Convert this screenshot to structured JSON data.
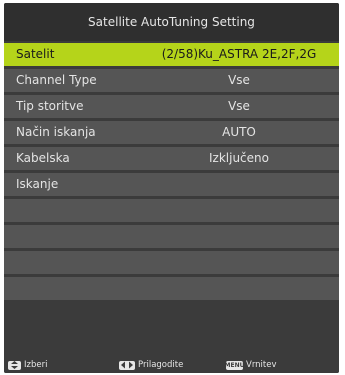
{
  "title": "Satellite AutoTuning Setting",
  "rows": [
    {
      "label": "Satelit",
      "value": "(2/58)Ku_ASTRA 2E,2F,2G"
    },
    {
      "label": "Channel Type",
      "value": "Vse"
    },
    {
      "label": "Tip storitve",
      "value": "Vse"
    },
    {
      "label": "Način iskanja",
      "value": "AUTO"
    },
    {
      "label": "Kabelska",
      "value": "Izključeno"
    },
    {
      "label": "Iskanje",
      "value": ""
    }
  ],
  "hints": {
    "select_label": "Izberi",
    "adjust_label": "Prilagodite",
    "back_label": "Vrnitev",
    "back_key": "MENU"
  },
  "colors": {
    "highlight": "#b5d41a",
    "row_bg": "#555555",
    "panel_bg": "#3b3b3b"
  },
  "icons": [
    "up-down-arrows-icon",
    "left-right-arrows-icon",
    "menu-key-icon"
  ]
}
